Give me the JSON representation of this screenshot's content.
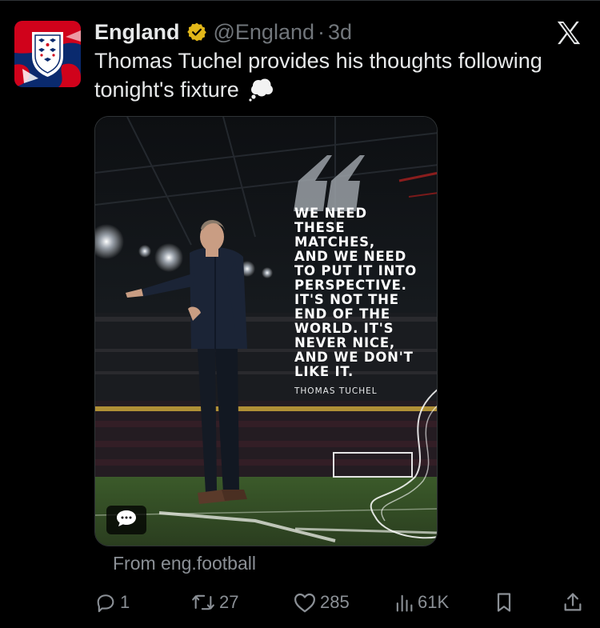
{
  "tweet": {
    "display_name": "England",
    "handle": "@England",
    "separator": "·",
    "time": "3d",
    "text": "Thomas Tuchel provides his thoughts following tonight's fixture",
    "emoji": "thought-balloon-icon"
  },
  "media": {
    "quote": "WE NEED\nTHESE\nMATCHES,\nAND WE NEED\nTO PUT IT INTO\nPERSPECTIVE.\nIT'S NOT THE\nEND OF THE\nWORLD. IT'S\nNEVER NICE,\nAND WE DON'T\nLIKE IT.",
    "quote_author": "THOMAS TUCHEL",
    "alt_icon": "speech-bubble-icon"
  },
  "source": "From eng.football",
  "actions": {
    "replies": "1",
    "reposts": "27",
    "likes": "285",
    "views": "61K"
  },
  "icons": {
    "verified": "verified-gold-badge-icon",
    "platform": "x-logo-icon",
    "reply": "reply-icon",
    "repost": "repost-icon",
    "like": "heart-icon",
    "views": "views-chart-icon",
    "bookmark": "bookmark-icon",
    "share": "share-icon"
  },
  "colors": {
    "background": "#000000",
    "text": "#e7e9ea",
    "muted": "#71767b",
    "verified_gold": "#e2b719",
    "england_red": "#d0021b",
    "england_blue": "#0a2a6e"
  }
}
